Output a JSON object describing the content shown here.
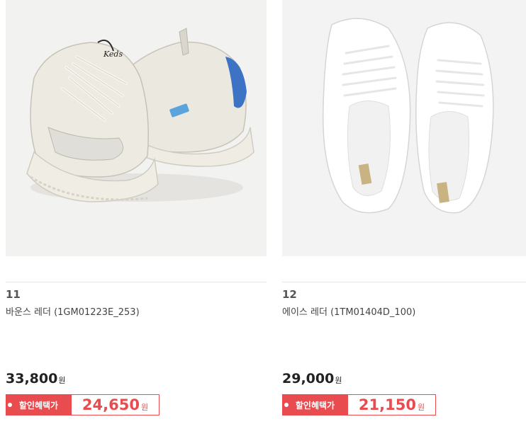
{
  "products": [
    {
      "number": "11",
      "name": "바운스 레더 (1GM01223E_253)",
      "price": "33,800",
      "price_unit": "원",
      "sale_label": "할인혜택가",
      "sale_price": "24,650",
      "sale_unit": "원",
      "image": "keds-bounce-leather-chunky-sneaker-image"
    },
    {
      "number": "12",
      "name": "에이스 레더 (1TM01404D_100)",
      "price": "29,000",
      "price_unit": "원",
      "sale_label": "할인혜택가",
      "sale_price": "21,150",
      "sale_unit": "원",
      "image": "keds-ace-leather-white-sneaker-image"
    }
  ],
  "colors": {
    "accent": "#e84c4f",
    "image_bg": "#f2f2f0"
  }
}
